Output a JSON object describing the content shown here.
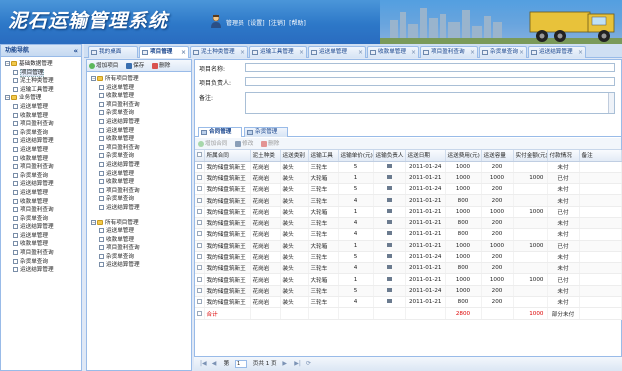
{
  "app": {
    "title": "泥石运输管理系统",
    "user_links": [
      "管理员",
      "[设置]",
      "[注销]",
      "[帮助]"
    ]
  },
  "left_nav": {
    "title": "功能导航",
    "collapse_icon": "double-chevron-left-icon",
    "items": [
      {
        "label": "基础数据管理",
        "level": 1,
        "type": "folder",
        "expanded": true
      },
      {
        "label": "项目管理",
        "level": 2,
        "type": "doc",
        "selected": true
      },
      {
        "label": "泥土种类管理",
        "level": 2,
        "type": "doc"
      },
      {
        "label": "运输工具管理",
        "level": 2,
        "type": "doc"
      },
      {
        "label": "业务管理",
        "level": 1,
        "type": "folder",
        "expanded": true
      },
      {
        "label": "运送单管理",
        "level": 2,
        "type": "doc"
      },
      {
        "label": "收款单管理",
        "level": 2,
        "type": "doc"
      },
      {
        "label": "项目盈利查询",
        "level": 2,
        "type": "doc"
      },
      {
        "label": "杂货单查询",
        "level": 2,
        "type": "doc"
      },
      {
        "label": "运送结算管理",
        "level": 2,
        "type": "doc"
      },
      {
        "label": "运送单管理",
        "level": 2,
        "type": "doc"
      },
      {
        "label": "收款单管理",
        "level": 2,
        "type": "doc"
      },
      {
        "label": "项目盈利查询",
        "level": 2,
        "type": "doc"
      },
      {
        "label": "杂货单查询",
        "level": 2,
        "type": "doc"
      },
      {
        "label": "运送结算管理",
        "level": 2,
        "type": "doc"
      },
      {
        "label": "运送单管理",
        "level": 2,
        "type": "doc"
      },
      {
        "label": "收款单管理",
        "level": 2,
        "type": "doc"
      },
      {
        "label": "项目盈利查询",
        "level": 2,
        "type": "doc"
      },
      {
        "label": "杂货单查询",
        "level": 2,
        "type": "doc"
      },
      {
        "label": "运送结算管理",
        "level": 2,
        "type": "doc"
      },
      {
        "label": "运送单管理",
        "level": 2,
        "type": "doc"
      },
      {
        "label": "收款单管理",
        "level": 2,
        "type": "doc"
      },
      {
        "label": "项目盈利查询",
        "level": 2,
        "type": "doc"
      },
      {
        "label": "杂货单查询",
        "level": 2,
        "type": "doc"
      },
      {
        "label": "运送结算管理",
        "level": 2,
        "type": "doc"
      }
    ]
  },
  "tabs": [
    {
      "label": "我的桌面",
      "active": false
    },
    {
      "label": "项目管理",
      "active": true
    },
    {
      "label": "泥土种类管理",
      "active": false
    },
    {
      "label": "运输工具管理",
      "active": false
    },
    {
      "label": "运送单管理",
      "active": false
    },
    {
      "label": "收款单管理",
      "active": false
    },
    {
      "label": "项目盈利查询",
      "active": false
    },
    {
      "label": "杂货单查询",
      "active": false
    },
    {
      "label": "运送结算管理",
      "active": false
    }
  ],
  "project_tree": {
    "toolbar": {
      "add": "增加项目",
      "save": "保存",
      "delete": "删除"
    },
    "groups": [
      {
        "label": "所有项目管理",
        "items": [
          "运送单管理",
          "收款单管理",
          "项目盈利查询",
          "杂货单查询",
          "运送结算管理",
          "运送单管理",
          "收款单管理",
          "项目盈利查询",
          "杂货单查询",
          "运送结算管理",
          "运送单管理",
          "收款单管理",
          "项目盈利查询",
          "杂货单查询",
          "运送结算管理"
        ]
      },
      {
        "label": "所有项目管理",
        "items": [
          "运送单管理",
          "收款单管理",
          "项目盈利查询",
          "杂货单查询",
          "运送结算管理"
        ]
      }
    ]
  },
  "form": {
    "name_label": "项目名称:",
    "owner_label": "项目负责人:",
    "note_label": "备注:",
    "name_value": "",
    "owner_value": "",
    "note_value": ""
  },
  "subtabs": [
    {
      "label": "合同管理",
      "active": true
    },
    {
      "label": "杂货管理",
      "active": false
    }
  ],
  "grid_toolbar": {
    "add": "增加合同",
    "edit": "修改",
    "delete": "删除"
  },
  "grid": {
    "columns": [
      "所属合同",
      "泥土种类",
      "运送类别",
      "运输工具",
      "运输单价(元)",
      "运输负责人",
      "运送日期",
      "运送费用(元)",
      "运送容量",
      "实付金额(元)",
      "付款情况",
      "备注"
    ],
    "rows": [
      [
        "我的储盘筑新王",
        "花岗岩",
        "装头",
        "三轮车",
        "5",
        "",
        "2011-01-24",
        "1000",
        "200",
        "",
        "未付",
        ""
      ],
      [
        "我的储盘筑新王",
        "花岗岩",
        "装头",
        "大轮箱",
        "1",
        "",
        "2011-01-21",
        "1000",
        "1000",
        "1000",
        "已付",
        ""
      ],
      [
        "我的储盘筑新王",
        "花岗岩",
        "装头",
        "三轮车",
        "5",
        "",
        "2011-01-24",
        "1000",
        "200",
        "",
        "未付",
        ""
      ],
      [
        "我的储盘筑新王",
        "花岗岩",
        "装头",
        "三轮车",
        "4",
        "",
        "2011-01-21",
        "800",
        "200",
        "",
        "未付",
        ""
      ],
      [
        "我的储盘筑新王",
        "花岗岩",
        "装头",
        "大轮箱",
        "1",
        "",
        "2011-01-21",
        "1000",
        "1000",
        "1000",
        "已付",
        ""
      ],
      [
        "我的储盘筑新王",
        "花岗岩",
        "装头",
        "三轮车",
        "4",
        "",
        "2011-01-21",
        "800",
        "200",
        "",
        "未付",
        ""
      ],
      [
        "我的储盘筑新王",
        "花岗岩",
        "装头",
        "三轮车",
        "4",
        "",
        "2011-01-21",
        "800",
        "200",
        "",
        "未付",
        ""
      ],
      [
        "我的储盘筑新王",
        "花岗岩",
        "装头",
        "大轮箱",
        "1",
        "",
        "2011-01-21",
        "1000",
        "1000",
        "1000",
        "已付",
        ""
      ],
      [
        "我的储盘筑新王",
        "花岗岩",
        "装头",
        "三轮车",
        "5",
        "",
        "2011-01-24",
        "1000",
        "200",
        "",
        "未付",
        ""
      ],
      [
        "我的储盘筑新王",
        "花岗岩",
        "装头",
        "三轮车",
        "4",
        "",
        "2011-01-21",
        "800",
        "200",
        "",
        "未付",
        ""
      ],
      [
        "我的储盘筑新王",
        "花岗岩",
        "装头",
        "大轮箱",
        "1",
        "",
        "2011-01-21",
        "1000",
        "1000",
        "1000",
        "已付",
        ""
      ],
      [
        "我的储盘筑新王",
        "花岗岩",
        "装头",
        "三轮车",
        "5",
        "",
        "2011-01-24",
        "1000",
        "200",
        "",
        "未付",
        ""
      ],
      [
        "我的储盘筑新王",
        "花岗岩",
        "装头",
        "三轮车",
        "4",
        "",
        "2011-01-21",
        "800",
        "200",
        "",
        "未付",
        ""
      ]
    ],
    "total": {
      "label": "合计",
      "fee": "2800",
      "paid": "1000",
      "status": "部分未付"
    }
  },
  "pager": {
    "page_label": "第",
    "page_value": "1",
    "of_label": "页共 1 页"
  }
}
